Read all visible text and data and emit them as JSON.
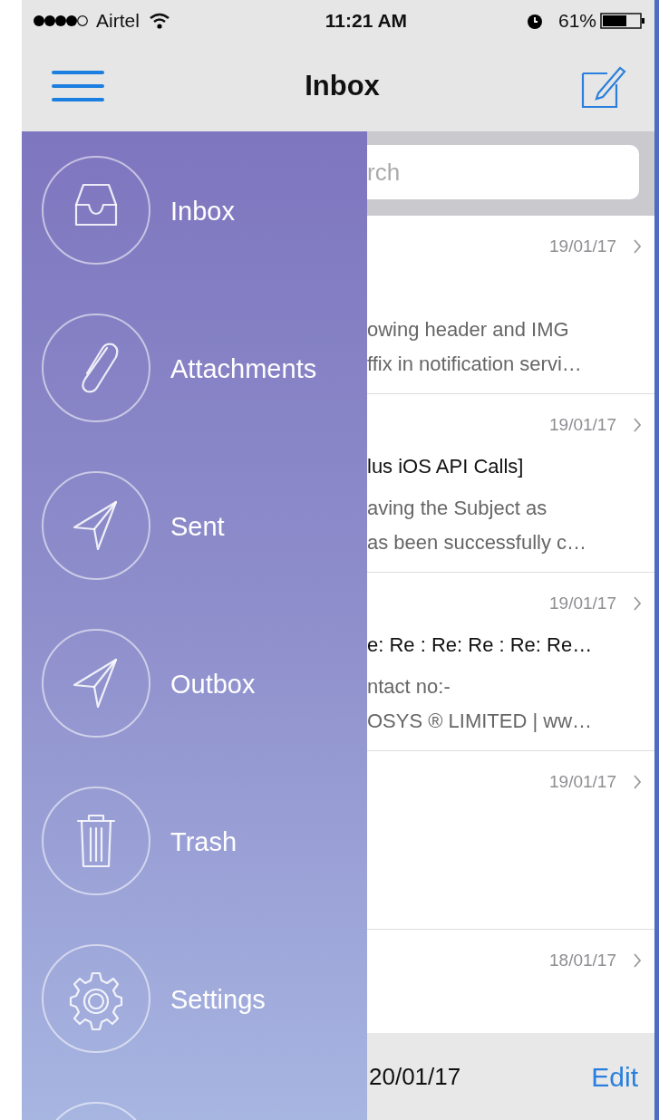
{
  "status_bar": {
    "carrier": "Airtel",
    "time": "11:21 AM",
    "battery": "61%"
  },
  "nav_bar": {
    "title": "Inbox"
  },
  "drawer": {
    "items": [
      {
        "label": "Inbox",
        "kind": "inbox"
      },
      {
        "label": "Attachments",
        "kind": "attachments"
      },
      {
        "label": "Sent",
        "kind": "sent"
      },
      {
        "label": "Outbox",
        "kind": "outbox"
      },
      {
        "label": "Trash",
        "kind": "trash"
      },
      {
        "label": "Settings",
        "kind": "settings"
      }
    ]
  },
  "search": {
    "placeholder": "rch"
  },
  "messages": [
    {
      "date": "19/01/17",
      "preview_lines": [
        "owing header and IMG",
        "ffix in notification servi…"
      ]
    },
    {
      "date": "19/01/17",
      "subject": "lus iOS API Calls]",
      "preview_lines": [
        "aving the Subject as",
        "as been successfully c…"
      ]
    },
    {
      "date": "19/01/17",
      "subject": "e: Re : Re: Re : Re: Re…",
      "preview_lines": [
        "ntact no:-",
        "OSYS ® LIMITED | ww…"
      ]
    },
    {
      "date": "19/01/17"
    },
    {
      "date": "18/01/17"
    }
  ],
  "toolbar": {
    "status": "20/01/17",
    "edit": "Edit"
  }
}
